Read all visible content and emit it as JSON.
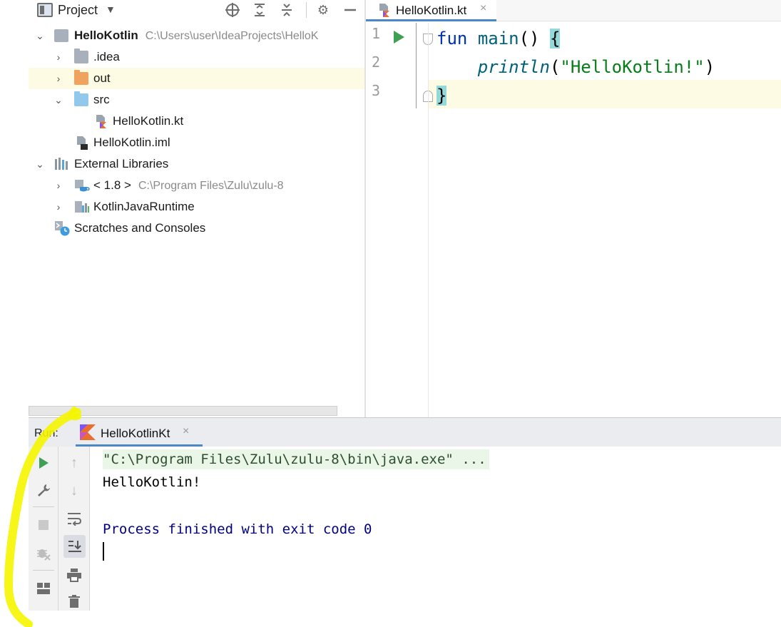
{
  "project_panel": {
    "title": "Project",
    "dropdown_icon": "chevron-down-icon",
    "header_buttons": [
      "locate-icon",
      "expand-all-icon",
      "collapse-all-icon",
      "gear-icon",
      "minimize-icon"
    ],
    "tree": {
      "root": {
        "name": "HelloKotlin",
        "path": "C:\\Users\\user\\IdeaProjects\\HelloK"
      },
      "idea": {
        "name": ".idea"
      },
      "out": {
        "name": "out"
      },
      "src": {
        "name": "src"
      },
      "kt_file": {
        "name": "HelloKotlin.kt"
      },
      "iml_file": {
        "name": "HelloKotlin.iml"
      },
      "ext_libs": {
        "name": "External Libraries"
      },
      "jdk": {
        "name": "< 1.8 >",
        "path": "C:\\Program Files\\Zulu\\zulu-8"
      },
      "kotlin_runtime": {
        "name": "KotlinJavaRuntime"
      },
      "scratches": {
        "name": "Scratches and Consoles"
      }
    }
  },
  "editor": {
    "tab": {
      "label": "HelloKotlin.kt",
      "close": "×"
    },
    "line_numbers": [
      "1",
      "2",
      "3"
    ],
    "code": {
      "l1_kw": "fun",
      "l1_fn": "main",
      "l1_rest": "() ",
      "l1_brace": "{",
      "l2_indent": "    ",
      "l2_call": "println",
      "l2_open": "(",
      "l2_str": "\"HelloKotlin!\"",
      "l2_close": ")",
      "l3_brace": "}"
    }
  },
  "run_panel": {
    "label": "Run:",
    "tab": {
      "label": "HelloKotlinKt",
      "close": "×"
    },
    "toolbar_left": [
      "rerun-icon",
      "wrench-icon",
      "stop-icon",
      "debug-icon",
      "layout-icon"
    ],
    "toolbar_right": [
      "up-arrow-icon",
      "down-arrow-icon",
      "soft-wrap-icon",
      "scroll-to-end-icon",
      "print-icon",
      "trash-icon"
    ],
    "console": {
      "command": "\"C:\\Program Files\\Zulu\\zulu-8\\bin\\java.exe\" ...",
      "output": "HelloKotlin!",
      "exit": "Process finished with exit code 0"
    }
  },
  "colors": {
    "keyword": "#0033b3",
    "function": "#00627a",
    "string": "#067d17",
    "run_green": "#3f9f55",
    "selection_yellow": "#fdfbe3",
    "annotation_yellow": "#f5f500"
  }
}
